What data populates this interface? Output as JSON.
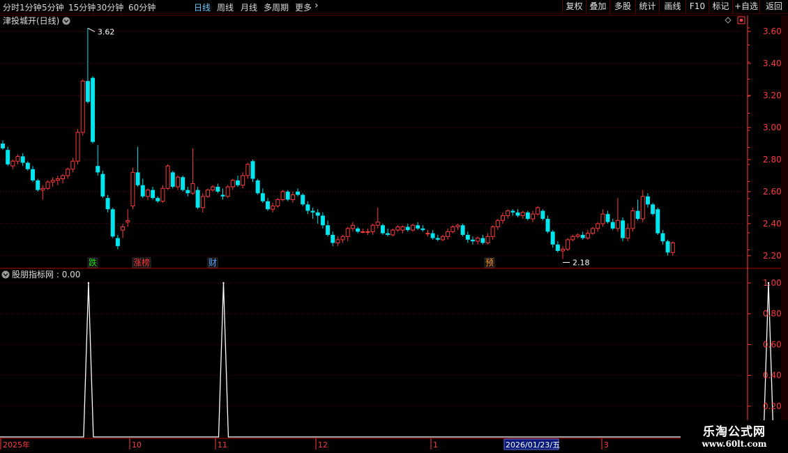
{
  "toolbar": {
    "periods": [
      "分时",
      "1分钟",
      "5分钟",
      "15分钟",
      "30分钟",
      "60分钟",
      "日线",
      "周线",
      "月线",
      "多周期",
      "更多"
    ],
    "active_period": "日线",
    "tools": [
      "复权",
      "叠加",
      "多股",
      "统计",
      "画线",
      "F10",
      "标记",
      "+自选",
      "返回"
    ]
  },
  "main_chart": {
    "title": "津投城开(日线)",
    "high_label": "3.62",
    "low_label": "2.18",
    "event_markers": [
      {
        "text": "跌",
        "color": "#22dd22"
      },
      {
        "text": "涨榜",
        "color": "#ff3b3b"
      },
      {
        "text": "财",
        "color": "#5aa8ff"
      },
      {
        "text": "预",
        "color": "#ff9922"
      }
    ]
  },
  "indicator": {
    "title": "股朋指标网",
    "value": "0.00"
  },
  "time_axis": {
    "labels": [
      "2025年",
      "10",
      "11",
      "12",
      "1",
      "2026/01/23/五",
      "3"
    ]
  },
  "watermark": {
    "title": "乐淘公式网",
    "url": "www.60lt.com"
  },
  "colors": {
    "up": "#ff3b3b",
    "down": "#00e5ee",
    "grid": "#7a0000",
    "axis": "#ff3b3b",
    "active": "#66c8ff"
  },
  "chart_data": [
    {
      "type": "candlestick",
      "title": "津投城开(日线)",
      "y_ticks": [
        "3.60",
        "3.40",
        "3.20",
        "3.00",
        "2.80",
        "2.60",
        "2.40",
        "2.20"
      ],
      "ylim": [
        2.13,
        3.7
      ],
      "ohlc": [
        [
          2.9,
          2.92,
          2.86,
          2.87
        ],
        [
          2.86,
          2.88,
          2.76,
          2.77
        ],
        [
          2.76,
          2.8,
          2.74,
          2.79
        ],
        [
          2.79,
          2.83,
          2.77,
          2.82
        ],
        [
          2.82,
          2.84,
          2.76,
          2.78
        ],
        [
          2.78,
          2.79,
          2.73,
          2.74
        ],
        [
          2.74,
          2.76,
          2.66,
          2.67
        ],
        [
          2.67,
          2.68,
          2.6,
          2.61
        ],
        [
          2.61,
          2.64,
          2.55,
          2.62
        ],
        [
          2.62,
          2.67,
          2.61,
          2.66
        ],
        [
          2.66,
          2.69,
          2.63,
          2.67
        ],
        [
          2.67,
          2.7,
          2.64,
          2.68
        ],
        [
          2.68,
          2.71,
          2.65,
          2.7
        ],
        [
          2.7,
          2.75,
          2.68,
          2.74
        ],
        [
          2.74,
          2.81,
          2.72,
          2.79
        ],
        [
          2.79,
          2.99,
          2.77,
          2.97
        ],
        [
          2.97,
          3.3,
          2.95,
          3.29
        ],
        [
          3.29,
          3.62,
          3.15,
          3.16
        ],
        [
          3.31,
          3.32,
          2.9,
          2.91
        ],
        [
          2.76,
          2.89,
          2.7,
          2.72
        ],
        [
          2.71,
          2.73,
          2.56,
          2.57
        ],
        [
          2.56,
          2.58,
          2.47,
          2.49
        ],
        [
          2.49,
          2.5,
          2.31,
          2.32
        ],
        [
          2.31,
          2.33,
          2.24,
          2.26
        ],
        [
          2.36,
          2.4,
          2.31,
          2.38
        ],
        [
          2.41,
          2.49,
          2.38,
          2.42
        ],
        [
          2.51,
          2.75,
          2.49,
          2.72
        ],
        [
          2.72,
          2.88,
          2.63,
          2.64
        ],
        [
          2.64,
          2.68,
          2.56,
          2.57
        ],
        [
          2.57,
          2.62,
          2.55,
          2.61
        ],
        [
          2.61,
          2.63,
          2.55,
          2.56
        ],
        [
          2.56,
          2.57,
          2.53,
          2.54
        ],
        [
          2.54,
          2.64,
          2.53,
          2.62
        ],
        [
          2.62,
          2.77,
          2.61,
          2.76
        ],
        [
          2.72,
          2.73,
          2.62,
          2.63
        ],
        [
          2.63,
          2.7,
          2.61,
          2.69
        ],
        [
          2.69,
          2.7,
          2.6,
          2.61
        ],
        [
          2.61,
          2.63,
          2.57,
          2.59
        ],
        [
          2.59,
          2.87,
          2.58,
          2.65
        ],
        [
          2.61,
          2.63,
          2.49,
          2.5
        ],
        [
          2.5,
          2.59,
          2.47,
          2.57
        ],
        [
          2.57,
          2.62,
          2.56,
          2.61
        ],
        [
          2.61,
          2.64,
          2.6,
          2.63
        ],
        [
          2.63,
          2.65,
          2.59,
          2.6
        ],
        [
          2.58,
          2.62,
          2.55,
          2.57
        ],
        [
          2.57,
          2.64,
          2.56,
          2.63
        ],
        [
          2.63,
          2.68,
          2.61,
          2.67
        ],
        [
          2.67,
          2.7,
          2.63,
          2.64
        ],
        [
          2.64,
          2.72,
          2.62,
          2.7
        ],
        [
          2.7,
          2.78,
          2.68,
          2.77
        ],
        [
          2.79,
          2.8,
          2.66,
          2.68
        ],
        [
          2.67,
          2.68,
          2.58,
          2.59
        ],
        [
          2.59,
          2.62,
          2.53,
          2.54
        ],
        [
          2.54,
          2.56,
          2.48,
          2.49
        ],
        [
          2.49,
          2.53,
          2.47,
          2.51
        ],
        [
          2.51,
          2.56,
          2.5,
          2.55
        ],
        [
          2.55,
          2.61,
          2.54,
          2.6
        ],
        [
          2.6,
          2.61,
          2.54,
          2.55
        ],
        [
          2.55,
          2.6,
          2.53,
          2.58
        ],
        [
          2.6,
          2.62,
          2.57,
          2.58
        ],
        [
          2.58,
          2.59,
          2.51,
          2.52
        ],
        [
          2.52,
          2.54,
          2.46,
          2.48
        ],
        [
          2.48,
          2.5,
          2.43,
          2.47
        ],
        [
          2.47,
          2.49,
          2.4,
          2.45
        ],
        [
          2.45,
          2.47,
          2.37,
          2.39
        ],
        [
          2.39,
          2.42,
          2.32,
          2.33
        ],
        [
          2.33,
          2.35,
          2.26,
          2.28
        ],
        [
          2.28,
          2.32,
          2.26,
          2.3
        ],
        [
          2.3,
          2.33,
          2.28,
          2.32
        ],
        [
          2.32,
          2.38,
          2.29,
          2.37
        ],
        [
          2.37,
          2.41,
          2.35,
          2.39
        ],
        [
          2.37,
          2.38,
          2.34,
          2.35
        ],
        [
          2.35,
          2.37,
          2.34,
          2.35
        ],
        [
          2.35,
          2.37,
          2.33,
          2.35
        ],
        [
          2.35,
          2.4,
          2.33,
          2.39
        ],
        [
          2.39,
          2.5,
          2.37,
          2.41
        ],
        [
          2.39,
          2.4,
          2.33,
          2.34
        ],
        [
          2.34,
          2.37,
          2.32,
          2.33
        ],
        [
          2.33,
          2.37,
          2.32,
          2.36
        ],
        [
          2.36,
          2.39,
          2.35,
          2.38
        ],
        [
          2.36,
          2.39,
          2.34,
          2.38
        ],
        [
          2.38,
          2.4,
          2.35,
          2.36
        ],
        [
          2.36,
          2.4,
          2.35,
          2.39
        ],
        [
          2.39,
          2.41,
          2.36,
          2.37
        ],
        [
          2.37,
          2.39,
          2.35,
          2.36
        ],
        [
          2.34,
          2.36,
          2.32,
          2.34
        ],
        [
          2.34,
          2.36,
          2.3,
          2.31
        ],
        [
          2.31,
          2.33,
          2.29,
          2.3
        ],
        [
          2.3,
          2.33,
          2.29,
          2.32
        ],
        [
          2.32,
          2.37,
          2.3,
          2.35
        ],
        [
          2.35,
          2.39,
          2.34,
          2.38
        ],
        [
          2.38,
          2.4,
          2.36,
          2.39
        ],
        [
          2.39,
          2.4,
          2.32,
          2.33
        ],
        [
          2.33,
          2.35,
          2.28,
          2.3
        ],
        [
          2.3,
          2.32,
          2.27,
          2.29
        ],
        [
          2.29,
          2.32,
          2.27,
          2.31
        ],
        [
          2.31,
          2.33,
          2.27,
          2.28
        ],
        [
          2.28,
          2.34,
          2.27,
          2.32
        ],
        [
          2.32,
          2.39,
          2.3,
          2.38
        ],
        [
          2.38,
          2.43,
          2.36,
          2.42
        ],
        [
          2.42,
          2.47,
          2.4,
          2.45
        ],
        [
          2.45,
          2.49,
          2.43,
          2.48
        ],
        [
          2.48,
          2.49,
          2.45,
          2.47
        ],
        [
          2.47,
          2.49,
          2.44,
          2.45
        ],
        [
          2.45,
          2.48,
          2.43,
          2.47
        ],
        [
          2.47,
          2.48,
          2.42,
          2.43
        ],
        [
          2.43,
          2.48,
          2.41,
          2.46
        ],
        [
          2.46,
          2.51,
          2.45,
          2.5
        ],
        [
          2.48,
          2.49,
          2.42,
          2.43
        ],
        [
          2.43,
          2.45,
          2.34,
          2.35
        ],
        [
          2.35,
          2.36,
          2.25,
          2.27
        ],
        [
          2.27,
          2.29,
          2.22,
          2.23
        ],
        [
          2.23,
          2.26,
          2.18,
          2.24
        ],
        [
          2.24,
          2.31,
          2.23,
          2.3
        ],
        [
          2.3,
          2.33,
          2.29,
          2.32
        ],
        [
          2.32,
          2.34,
          2.31,
          2.33
        ],
        [
          2.33,
          2.35,
          2.3,
          2.31
        ],
        [
          2.31,
          2.36,
          2.3,
          2.34
        ],
        [
          2.34,
          2.38,
          2.33,
          2.37
        ],
        [
          2.37,
          2.41,
          2.35,
          2.4
        ],
        [
          2.4,
          2.49,
          2.38,
          2.46
        ],
        [
          2.46,
          2.48,
          2.4,
          2.41
        ],
        [
          2.41,
          2.43,
          2.36,
          2.37
        ],
        [
          2.37,
          2.56,
          2.35,
          2.42
        ],
        [
          2.42,
          2.44,
          2.29,
          2.31
        ],
        [
          2.31,
          2.4,
          2.29,
          2.37
        ],
        [
          2.37,
          2.5,
          2.35,
          2.48
        ],
        [
          2.48,
          2.55,
          2.42,
          2.43
        ],
        [
          2.43,
          2.61,
          2.41,
          2.57
        ],
        [
          2.57,
          2.59,
          2.5,
          2.52
        ],
        [
          2.52,
          2.53,
          2.45,
          2.46
        ],
        [
          2.49,
          2.5,
          2.33,
          2.34
        ],
        [
          2.34,
          2.36,
          2.27,
          2.29
        ],
        [
          2.29,
          2.3,
          2.2,
          2.22
        ],
        [
          2.22,
          2.29,
          2.2,
          2.28
        ]
      ]
    },
    {
      "type": "line",
      "title": "股朋指标网",
      "y_ticks": [
        "1.00",
        "0.80",
        "0.60",
        "0.40",
        "0.20"
      ],
      "ylim": [
        0,
        1.05
      ],
      "signal_bars": [
        17,
        44,
        153,
        167
      ],
      "values_note_free": true
    }
  ]
}
